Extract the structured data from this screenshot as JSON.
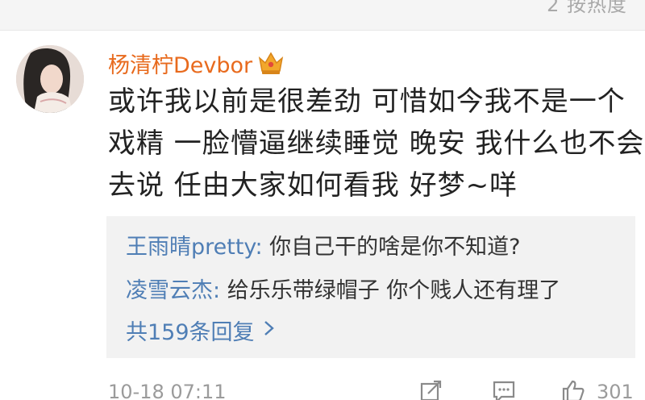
{
  "header": {
    "hot_label": "2 按热度"
  },
  "post": {
    "username": "杨清柠Devbor",
    "badge_icon": "vip-crown-icon",
    "lines": [
      "或许我以前是很差劲 可惜如今我不是一个",
      "戏精 一脸懵逼继续睡觉 晚安 我什么也不会",
      "去说 任由大家如何看我 好梦~咩"
    ]
  },
  "replies": [
    {
      "name": "王雨晴pretty",
      "sep": ":",
      "text": " 你自己干的啥是你不知道?"
    },
    {
      "name": "凌雪云杰",
      "sep": ":",
      "text": " 给乐乐带绿帽子 你个贱人还有理了"
    }
  ],
  "total_replies": {
    "label": "共159条回复",
    "icon": "chevron-right-icon"
  },
  "footer": {
    "timestamp": "10-18 07:11",
    "forward_icon": "forward-icon",
    "comment_icon": "comment-icon",
    "like_icon": "like-icon",
    "like_count": "301"
  },
  "colors": {
    "username": "#e86a1d",
    "link": "#4f7eb5",
    "reply_bg": "#f2f2f2"
  }
}
